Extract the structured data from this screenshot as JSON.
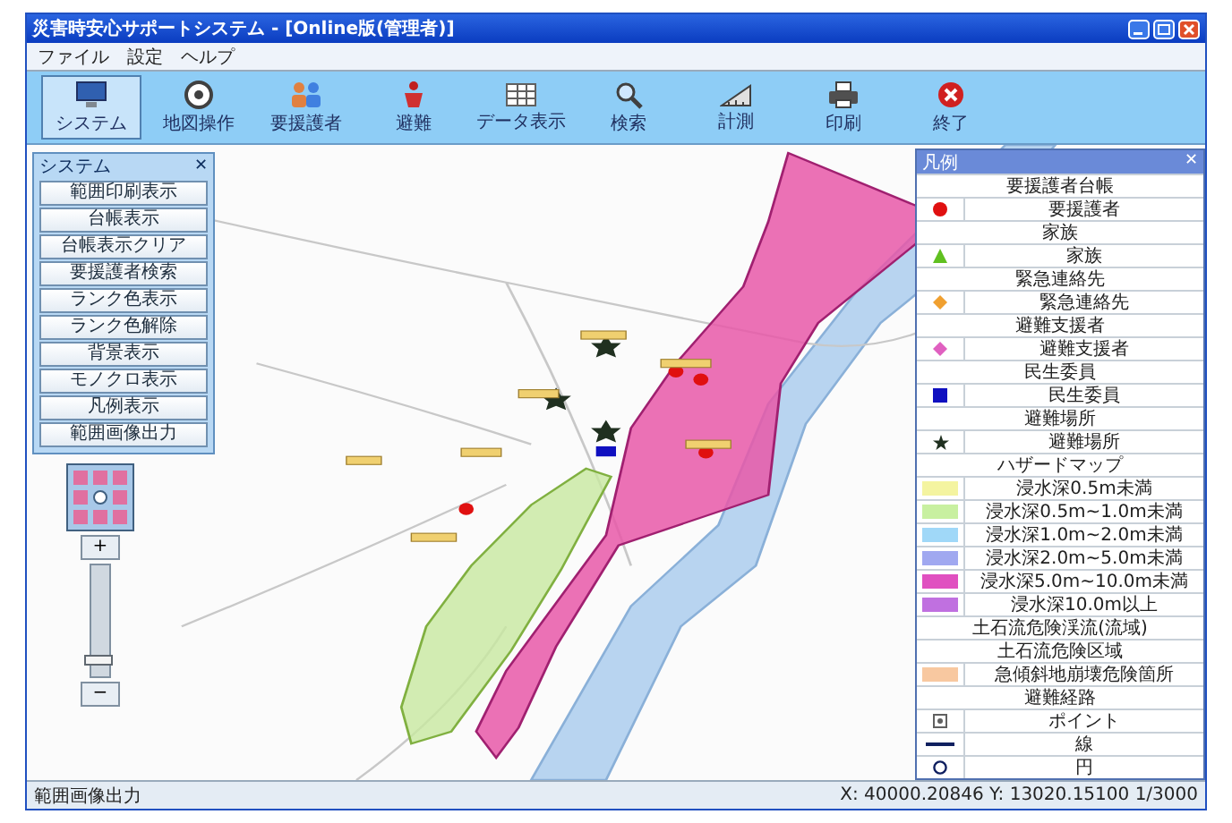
{
  "window": {
    "title": "災害時安心サポートシステム - [Online版(管理者)]"
  },
  "menu": [
    "ファイル",
    "設定",
    "ヘルプ"
  ],
  "toolbar": [
    {
      "label": "システム",
      "selected": true
    },
    {
      "label": "地図操作",
      "selected": false
    },
    {
      "label": "要援護者",
      "selected": false
    },
    {
      "label": "避難",
      "selected": false
    },
    {
      "label": "データ表示",
      "selected": false
    },
    {
      "label": "検索",
      "selected": false
    },
    {
      "label": "計測",
      "selected": false
    },
    {
      "label": "印刷",
      "selected": false
    },
    {
      "label": "終了",
      "selected": false
    }
  ],
  "side_panel": {
    "title": "システム",
    "close": "✕",
    "buttons": [
      "範囲印刷表示",
      "台帳表示",
      "台帳表示クリア",
      "要援護者検索",
      "ランク色表示",
      "ランク色解除",
      "背景表示",
      "モノクロ表示",
      "凡例表示",
      "範囲画像出力"
    ]
  },
  "zoom": {
    "plus": "+",
    "minus": "−",
    "level": 0.1
  },
  "legend": {
    "title": "凡例",
    "close": "✕",
    "rows": [
      {
        "kind": "header",
        "label": "要援護者台帳"
      },
      {
        "kind": "dot",
        "label": "要援護者",
        "color": "#e01010"
      },
      {
        "kind": "header",
        "label": "家族"
      },
      {
        "kind": "triangle",
        "label": "家族",
        "color": "#60c020"
      },
      {
        "kind": "header",
        "label": "緊急連絡先"
      },
      {
        "kind": "diamond",
        "label": "緊急連絡先",
        "color": "#f0a030"
      },
      {
        "kind": "header",
        "label": "避難支援者"
      },
      {
        "kind": "diamond",
        "label": "避難支援者",
        "color": "#e060c0"
      },
      {
        "kind": "header",
        "label": "民生委員"
      },
      {
        "kind": "square",
        "label": "民生委員",
        "color": "#1010c0"
      },
      {
        "kind": "header",
        "label": "避難場所"
      },
      {
        "kind": "star",
        "label": "避難場所",
        "color": "#203020"
      },
      {
        "kind": "header",
        "label": "ハザードマップ"
      },
      {
        "kind": "swatch",
        "label": "浸水深0.5m未満",
        "color": "#f4f4a0"
      },
      {
        "kind": "swatch",
        "label": "浸水深0.5m~1.0m未満",
        "color": "#c8f0a0"
      },
      {
        "kind": "swatch",
        "label": "浸水深1.0m~2.0m未満",
        "color": "#a0d8f8"
      },
      {
        "kind": "swatch",
        "label": "浸水深2.0m~5.0m未満",
        "color": "#a0a8f0"
      },
      {
        "kind": "swatch",
        "label": "浸水深5.0m~10.0m未満",
        "color": "#e050c0"
      },
      {
        "kind": "swatch",
        "label": "浸水深10.0m以上",
        "color": "#c070e0"
      },
      {
        "kind": "header",
        "label": "土石流危険渓流(流域)"
      },
      {
        "kind": "header",
        "label": "土石流危険区域"
      },
      {
        "kind": "swatch",
        "label": "急傾斜地崩壊危険箇所",
        "color": "#f8c8a0"
      },
      {
        "kind": "header",
        "label": "避難経路"
      },
      {
        "kind": "point",
        "label": "ポイント",
        "color": "#606060"
      },
      {
        "kind": "line",
        "label": "線",
        "color": "#102060"
      },
      {
        "kind": "circle",
        "label": "円",
        "color": "#102060"
      }
    ]
  },
  "status_bar": {
    "message": "範囲画像出力",
    "coordinates": "X: 40000.20846 Y: 13020.15100 1/3000"
  }
}
